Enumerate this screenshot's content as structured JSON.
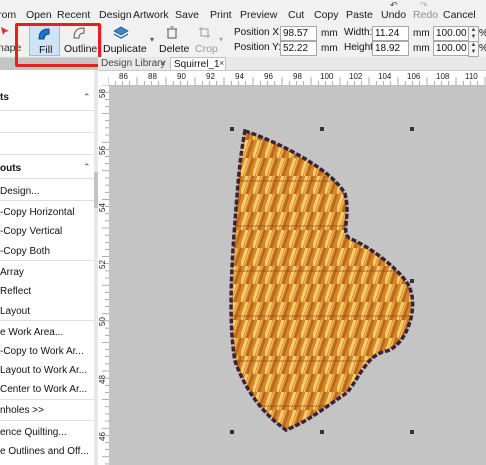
{
  "ribbon_top": {
    "items": [
      {
        "id": "prom",
        "label": "rom",
        "disabled": false
      },
      {
        "id": "open",
        "label": "Open",
        "disabled": false
      },
      {
        "id": "recent",
        "label": "Recent",
        "disabled": false
      },
      {
        "id": "design",
        "label": "Design",
        "disabled": false
      },
      {
        "id": "artwork",
        "label": "Artwork",
        "disabled": false
      },
      {
        "id": "save",
        "label": "Save",
        "disabled": false
      },
      {
        "id": "print",
        "label": "Print",
        "disabled": false
      },
      {
        "id": "preview",
        "label": "Preview",
        "disabled": false
      },
      {
        "id": "cut",
        "label": "Cut",
        "disabled": false
      },
      {
        "id": "copy",
        "label": "Copy",
        "disabled": false
      },
      {
        "id": "paste",
        "label": "Paste",
        "disabled": false
      },
      {
        "id": "undo",
        "label": "Undo",
        "disabled": false
      },
      {
        "id": "redo",
        "label": "Redo",
        "disabled": true
      },
      {
        "id": "cancel",
        "label": "Cancel",
        "disabled": false
      }
    ]
  },
  "ribbon": {
    "shape_label": "nape",
    "fill_label": "Fill",
    "outline_label": "Outline",
    "duplicate_label": "Duplicate",
    "delete_label": "Delete",
    "crop_label": "Crop",
    "position_x_label": "Position X:",
    "position_x_value": "98.57",
    "position_y_label": "Position Y:",
    "position_y_value": "52.22",
    "width_label": "Width:",
    "width_value": "11.24",
    "height_label": "Height:",
    "height_value": "18.92",
    "unit_mm": "mm",
    "scale_w_value": "100.00",
    "scale_h_value": "100.00",
    "unit_pct": "%"
  },
  "tabs": {
    "design_library": "Design Library",
    "design_library_close": "×",
    "squirrel": "Squirrel_1",
    "squirrel_close": "×"
  },
  "panel": {
    "items": [
      {
        "label": "ts",
        "header": true
      },
      {
        "label": "",
        "header": false
      },
      {
        "label": "outs",
        "header": true
      },
      {
        "label": "Design...",
        "header": false
      },
      {
        "label": "-Copy Horizontal",
        "header": false
      },
      {
        "label": "-Copy Vertical",
        "header": false
      },
      {
        "label": "-Copy Both",
        "header": false
      },
      {
        "label": "Array",
        "header": false
      },
      {
        "label": "Reflect",
        "header": false
      },
      {
        "label": "Layout",
        "header": false
      },
      {
        "label": "e Work Area...",
        "header": false
      },
      {
        "label": "-Copy to Work Ar...",
        "header": false
      },
      {
        "label": "Layout to Work Ar...",
        "header": false
      },
      {
        "label": "Center to Work Ar...",
        "header": false
      },
      {
        "label": "nholes >>",
        "header": false
      },
      {
        "label": "ence Quilting...",
        "header": false
      },
      {
        "label": "e Outlines and Off...",
        "header": false
      }
    ],
    "chevron_up": "⌃",
    "chevron_down": "⌄"
  },
  "hruler": {
    "labels": [
      "86",
      "88",
      "90",
      "92",
      "94",
      "96",
      "98",
      "100",
      "102",
      "104",
      "106",
      "108",
      "110"
    ]
  },
  "vruler": {
    "labels": [
      "46",
      "48",
      "50",
      "52",
      "54",
      "56",
      "58"
    ]
  },
  "colors": {
    "accent_blue": "#1f74c4",
    "highlight_red": "#e42020",
    "canvas_gray": "#c4c4c4",
    "stitch_orange": "#e59a3a",
    "outline_dark": "#3a2338"
  }
}
